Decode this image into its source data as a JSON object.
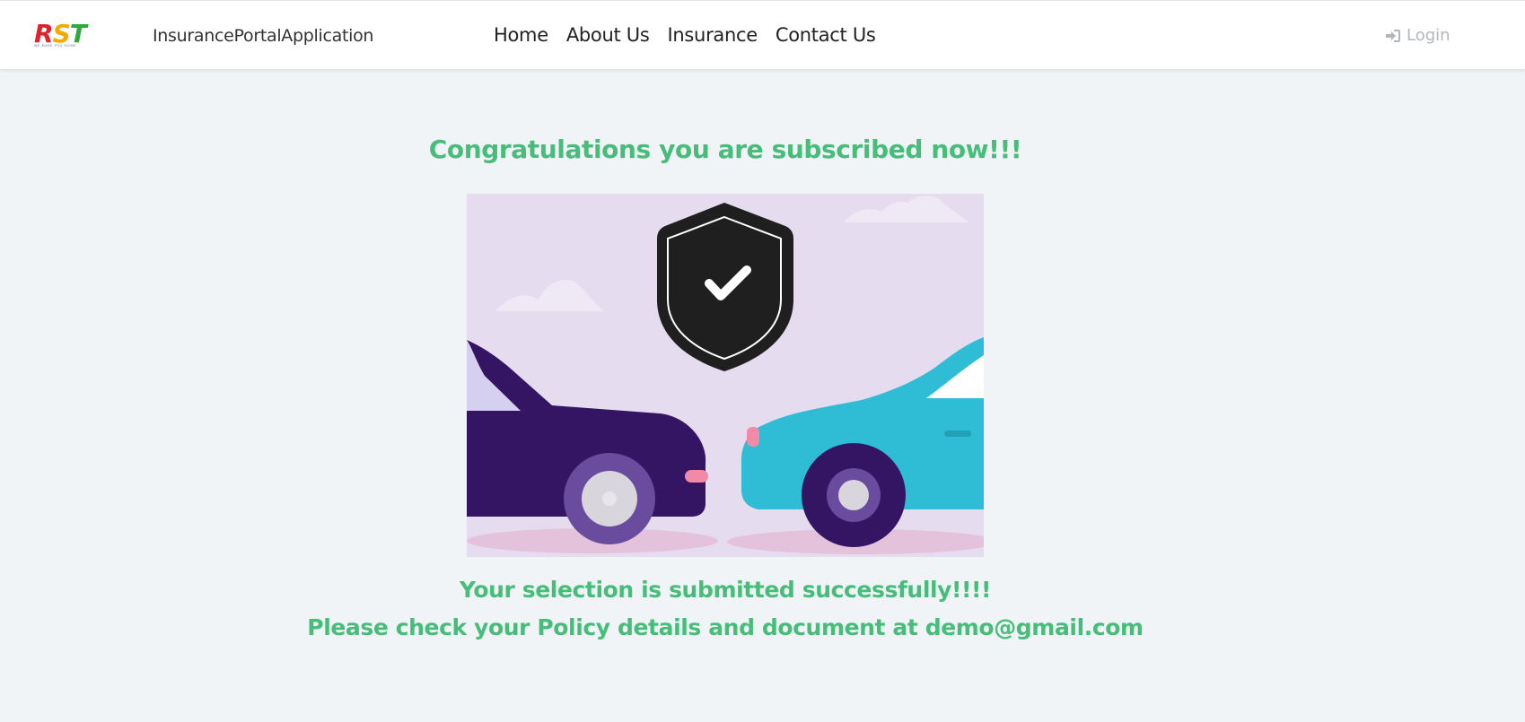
{
  "header": {
    "logo_text": "RST",
    "logo_tagline": "WE MAKE YOU SHINE",
    "brand": "InsurancePortalApplication",
    "nav": [
      "Home",
      "About Us",
      "Insurance",
      "Contact Us"
    ],
    "login_label": "Login",
    "login_icon": "sign-in-icon"
  },
  "main": {
    "title": "Congratulations you are subscribed now!!!",
    "illustration_icon": "shield-check-icon",
    "message_line1": "Your selection is submitted successfully!!!!",
    "message_line2": "Please check your Policy details and document at demo@gmail.com"
  },
  "colors": {
    "accent_green": "#46bd78",
    "background": "#f0f4f7",
    "logo_r": "#e0222b",
    "logo_s": "#f2a900",
    "logo_t": "#2eaa3a"
  }
}
